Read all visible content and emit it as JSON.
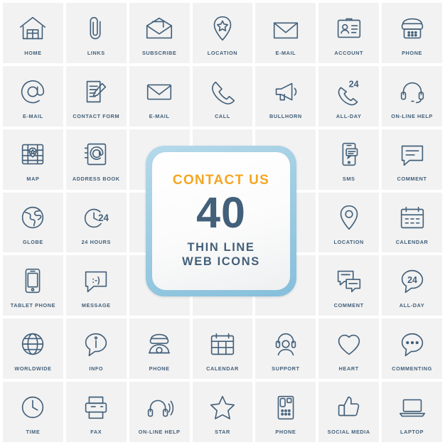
{
  "center_panel": {
    "title": "CONTACT US",
    "number": "40",
    "subtitle_line1": "THIN LINE",
    "subtitle_line2": "WEB ICONS",
    "accent_color": "#f5a623",
    "text_color": "#43607a",
    "frame_color": "#9fcde3"
  },
  "style": {
    "icon_color": "#43607a",
    "tile_background": "#f2f2f2",
    "page_background": "#ffffff"
  },
  "icons": [
    {
      "label": "HOME",
      "icon": "home-icon"
    },
    {
      "label": "LINKS",
      "icon": "paperclip-icon"
    },
    {
      "label": "SUBSCRIBE",
      "icon": "open-envelope-icon"
    },
    {
      "label": "LOCATION",
      "icon": "map-pin-star-icon"
    },
    {
      "label": "E-MAIL",
      "icon": "open-mail-icon"
    },
    {
      "label": "ACCOUNT",
      "icon": "id-card-icon"
    },
    {
      "label": "PHONE",
      "icon": "retro-telephone-icon"
    },
    {
      "label": "E-MAIL",
      "icon": "at-sign-icon"
    },
    {
      "label": "CONTACT FORM",
      "icon": "form-pencil-icon"
    },
    {
      "label": "E-MAIL",
      "icon": "envelope-icon"
    },
    {
      "label": "CALL",
      "icon": "handset-icon"
    },
    {
      "label": "BULLHORN",
      "icon": "bullhorn-icon"
    },
    {
      "label": "ALL-DAY",
      "icon": "handset-24-icon"
    },
    {
      "label": "ON-LINE HELP",
      "icon": "headset-icon"
    },
    {
      "label": "MAP",
      "icon": "map-marker-grid-icon"
    },
    {
      "label": "ADDRESS BOOK",
      "icon": "address-book-icon"
    },
    {
      "label": "",
      "icon": "center-panel"
    },
    {
      "label": "",
      "icon": "center-panel"
    },
    {
      "label": "",
      "icon": "center-panel"
    },
    {
      "label": "SMS",
      "icon": "phone-message-icon"
    },
    {
      "label": "COMMENT",
      "icon": "speech-bubble-lines-icon"
    },
    {
      "label": "GLOBE",
      "icon": "globe-icon"
    },
    {
      "label": "24 HOURS",
      "icon": "clock-24-icon"
    },
    {
      "label": "",
      "icon": "center-panel"
    },
    {
      "label": "",
      "icon": "center-panel"
    },
    {
      "label": "",
      "icon": "center-panel"
    },
    {
      "label": "LOCATION",
      "icon": "map-pin-icon"
    },
    {
      "label": "CALENDAR",
      "icon": "calendar-icon"
    },
    {
      "label": "TABLET PHONE",
      "icon": "smartphone-icon"
    },
    {
      "label": "MESSAGE",
      "icon": "smiley-bubble-icon"
    },
    {
      "label": "",
      "icon": "center-panel"
    },
    {
      "label": "",
      "icon": "center-panel"
    },
    {
      "label": "",
      "icon": "center-panel"
    },
    {
      "label": "COMMENT",
      "icon": "double-bubble-icon"
    },
    {
      "label": "ALL-DAY",
      "icon": "bubble-24-icon"
    },
    {
      "label": "WORLDWIDE",
      "icon": "wire-globe-icon"
    },
    {
      "label": "INFO",
      "icon": "info-bubble-icon"
    },
    {
      "label": "PHONE",
      "icon": "rotary-phone-icon"
    },
    {
      "label": "CALENDAR",
      "icon": "calendar-grid-icon"
    },
    {
      "label": "SUPPORT",
      "icon": "support-agent-icon"
    },
    {
      "label": "HEART",
      "icon": "heart-icon"
    },
    {
      "label": "COMMENTING",
      "icon": "ellipsis-bubble-icon"
    },
    {
      "label": "TIME",
      "icon": "clock-icon"
    },
    {
      "label": "FAX",
      "icon": "fax-icon"
    },
    {
      "label": "ON-LINE HELP",
      "icon": "headphones-icon"
    },
    {
      "label": "STAR",
      "icon": "star-icon"
    },
    {
      "label": "PHONE",
      "icon": "desk-phone-icon"
    },
    {
      "label": "SOCIAL MEDIA",
      "icon": "thumbs-up-icon"
    },
    {
      "label": "LAPTOP",
      "icon": "laptop-icon"
    }
  ]
}
